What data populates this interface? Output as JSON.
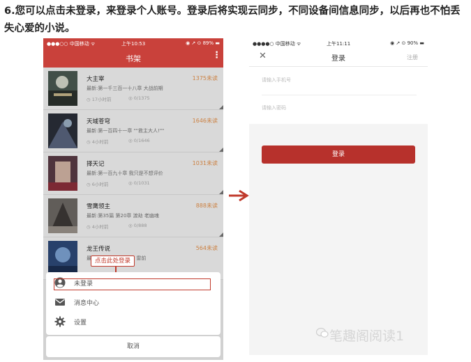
{
  "caption": "6.您可以点击未登录，来登录个人账号。登录后将实现云同步，不同设备间信息同步，以后再也不怕丢失心爱的小说。",
  "left_screen": {
    "status": {
      "carrier": "●●●○○ 中国移动 ᯤ",
      "time": "上午10:53",
      "battery": "◉ ↗ ⊙ 89% ▬"
    },
    "nav_title": "书架",
    "nav_menu": "⋮",
    "books": [
      {
        "title": "大主宰",
        "progress": "1375未读",
        "latest": "最新:第一千三百一十八章 大战前期",
        "meta1": "◷ 17小时前",
        "meta2": "◎ 0/1375"
      },
      {
        "title": "天域苍穹",
        "progress": "1646未读",
        "latest": "最新:第一百四十一章 \"\"救主大人!\"\"",
        "meta1": "◷ 4小时前",
        "meta2": "◎ 0/1646"
      },
      {
        "title": "择天记",
        "progress": "1031未读",
        "latest": "最新:第一百九十章 我只是不想评价",
        "meta1": "◷ 6小时前",
        "meta2": "◎ 0/1031"
      },
      {
        "title": "雪鹰领主",
        "progress": "888未读",
        "latest": "最新:第35篇 第20章 渡劫 老幽魂",
        "meta1": "◷ 4小时前",
        "meta2": "◎ 0/888"
      },
      {
        "title": "龙王传说",
        "progress": "564未读",
        "latest": "最新:第一百 · 章 · 复 · 雷前",
        "meta1": "",
        "meta2": ""
      }
    ],
    "callout": "点击此处登录",
    "sheet": {
      "login": "未登录",
      "messages": "消息中心",
      "settings": "设置"
    },
    "cancel": "取消",
    "colors": {
      "primary": "#c9413b",
      "progress": "#e8934c"
    }
  },
  "right_screen": {
    "status": {
      "carrier": "●●●●○ 中国移动 ᯤ",
      "time": "上午11:11",
      "battery": "◉ ↗ ⊙ 90% ▬"
    },
    "close": "✕",
    "title": "登录",
    "register": "注册",
    "phone_placeholder": "请输入手机号",
    "password_placeholder": "请输入密码",
    "login_button": "登录",
    "colors": {
      "button": "#b7312c"
    }
  },
  "watermark": "笔趣阁阅读1"
}
